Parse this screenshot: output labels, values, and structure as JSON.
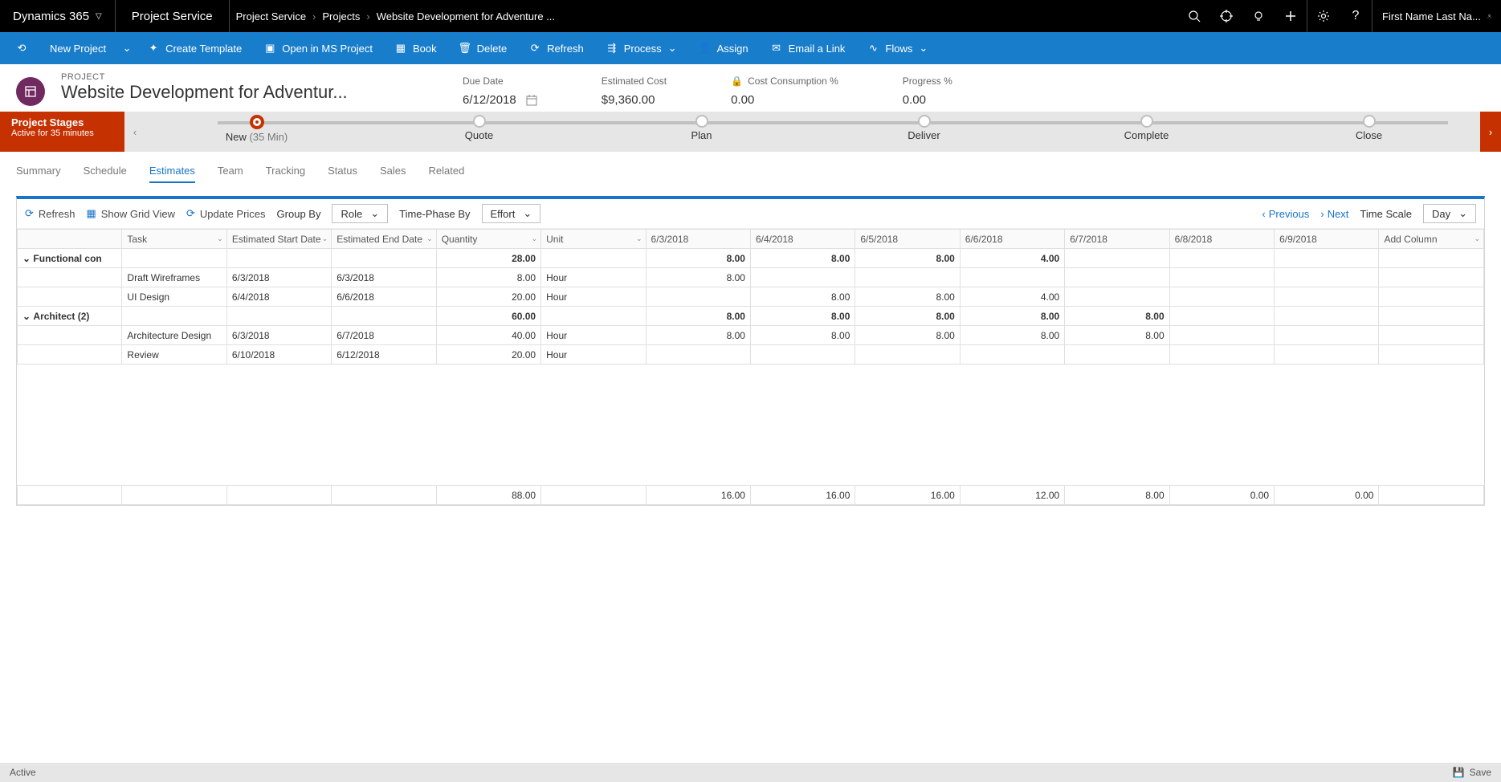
{
  "top": {
    "brand": "Dynamics 365",
    "product": "Project Service",
    "breadcrumb": [
      "Project Service",
      "Projects",
      "Website Development for Adventure ..."
    ],
    "user": "First Name Last Na..."
  },
  "commands": {
    "new_project": "New Project",
    "create_template": "Create Template",
    "open_ms_project": "Open in MS Project",
    "book": "Book",
    "delete": "Delete",
    "refresh": "Refresh",
    "process": "Process",
    "assign": "Assign",
    "email_link": "Email a Link",
    "flows": "Flows"
  },
  "project": {
    "label": "PROJECT",
    "name": "Website Development for Adventur...",
    "due_date_label": "Due Date",
    "due_date": "6/12/2018",
    "est_cost_label": "Estimated Cost",
    "est_cost": "$9,360.00",
    "cost_cons_label": "Cost Consumption %",
    "cost_cons": "0.00",
    "progress_label": "Progress %",
    "progress": "0.00"
  },
  "stages": {
    "box_title": "Project Stages",
    "box_sub": "Active for 35 minutes",
    "items": [
      {
        "name": "New",
        "time": "(35 Min)",
        "active": true
      },
      {
        "name": "Quote"
      },
      {
        "name": "Plan"
      },
      {
        "name": "Deliver"
      },
      {
        "name": "Complete"
      },
      {
        "name": "Close"
      }
    ]
  },
  "tabs": [
    "Summary",
    "Schedule",
    "Estimates",
    "Team",
    "Tracking",
    "Status",
    "Sales",
    "Related"
  ],
  "active_tab": "Estimates",
  "grid_toolbar": {
    "refresh": "Refresh",
    "grid_view": "Show Grid View",
    "update_prices": "Update Prices",
    "group_by_label": "Group By",
    "group_by_value": "Role",
    "time_phase_label": "Time-Phase By",
    "time_phase_value": "Effort",
    "previous": "Previous",
    "next": "Next",
    "time_scale_label": "Time Scale",
    "time_scale_value": "Day"
  },
  "grid": {
    "columns": {
      "task": "Task",
      "start": "Estimated Start Date",
      "end": "Estimated End Date",
      "qty": "Quantity",
      "unit": "Unit",
      "add_column": "Add Column"
    },
    "date_cols": [
      "6/3/2018",
      "6/4/2018",
      "6/5/2018",
      "6/6/2018",
      "6/7/2018",
      "6/8/2018",
      "6/9/2018"
    ],
    "groups": [
      {
        "label": "Functional con",
        "qty": "28.00",
        "days": [
          "8.00",
          "8.00",
          "8.00",
          "4.00",
          "",
          "",
          ""
        ],
        "rows": [
          {
            "task": "Draft Wireframes",
            "start": "6/3/2018",
            "end": "6/3/2018",
            "qty": "8.00",
            "unit": "Hour",
            "days": [
              "8.00",
              "",
              "",
              "",
              "",
              "",
              ""
            ]
          },
          {
            "task": "UI Design",
            "start": "6/4/2018",
            "end": "6/6/2018",
            "qty": "20.00",
            "unit": "Hour",
            "days": [
              "",
              "8.00",
              "8.00",
              "4.00",
              "",
              "",
              ""
            ]
          }
        ]
      },
      {
        "label": "Architect (2)",
        "qty": "60.00",
        "days": [
          "8.00",
          "8.00",
          "8.00",
          "8.00",
          "8.00",
          "",
          ""
        ],
        "rows": [
          {
            "task": "Architecture Design",
            "start": "6/3/2018",
            "end": "6/7/2018",
            "qty": "40.00",
            "unit": "Hour",
            "days": [
              "8.00",
              "8.00",
              "8.00",
              "8.00",
              "8.00",
              "",
              ""
            ]
          },
          {
            "task": "Review",
            "start": "6/10/2018",
            "end": "6/12/2018",
            "qty": "20.00",
            "unit": "Hour",
            "days": [
              "",
              "",
              "",
              "",
              "",
              "",
              ""
            ]
          }
        ]
      }
    ],
    "footer": {
      "qty": "88.00",
      "days": [
        "16.00",
        "16.00",
        "16.00",
        "12.00",
        "8.00",
        "0.00",
        "0.00"
      ]
    }
  },
  "status_bar": {
    "status": "Active",
    "save": "Save"
  }
}
